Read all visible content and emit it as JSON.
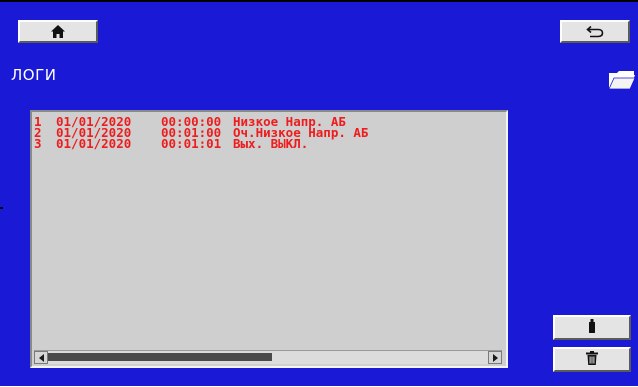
{
  "colors": {
    "background": "#1a1ad6",
    "button_face": "#e4e4e4",
    "log_panel": "#cfcfcf",
    "log_text": "#ee1c1c",
    "title_text": "#ffffff"
  },
  "toolbar": {
    "home_icon": "home-icon",
    "back_icon": "back-arrow-icon"
  },
  "page": {
    "title": "ЛОГИ",
    "folder_icon": "folder-icon"
  },
  "logs": {
    "rows": [
      {
        "num": "1",
        "date": "01/01/2020",
        "time": "00:00:00",
        "message": "Низкое Напр. АБ"
      },
      {
        "num": "2",
        "date": "01/01/2020",
        "time": "00:01:00",
        "message": "Оч.Низкое Напр. АБ"
      },
      {
        "num": "3",
        "date": "01/01/2020",
        "time": "00:01:01",
        "message": "Вых. ВЫКЛ."
      }
    ]
  },
  "side_buttons": {
    "usb_icon": "usb-drive-icon",
    "delete_icon": "trash-icon"
  }
}
